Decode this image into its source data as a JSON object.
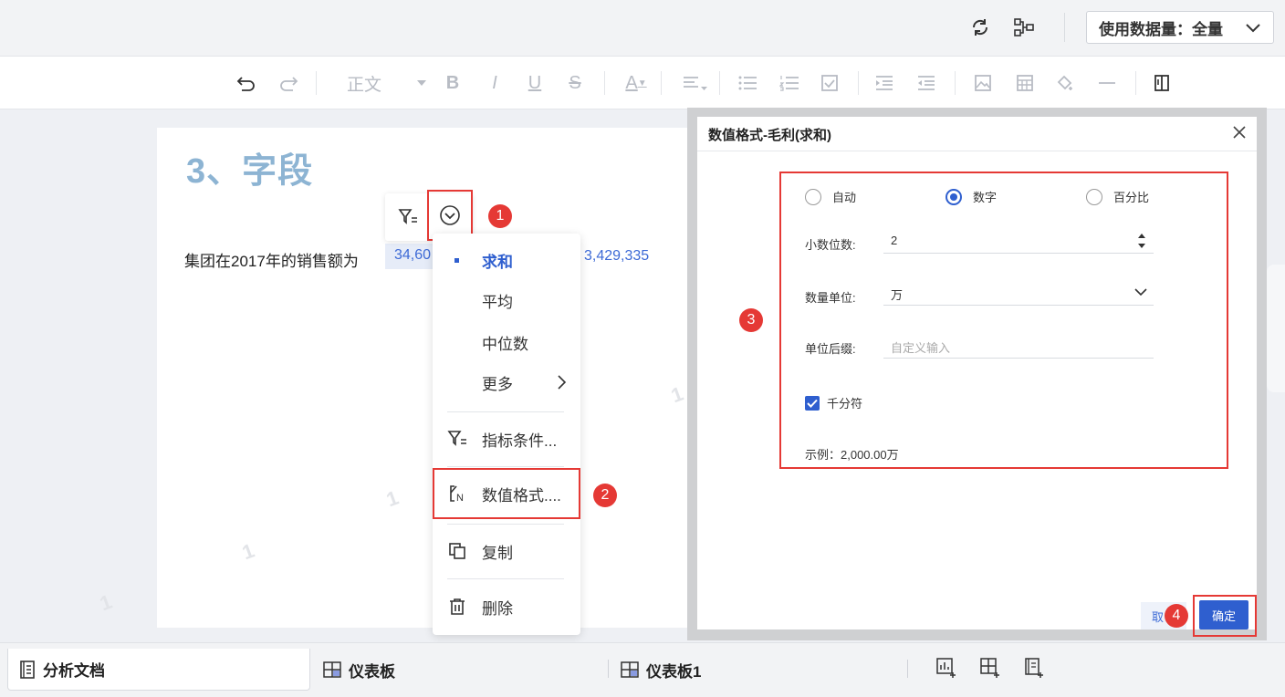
{
  "topbar": {
    "refresh_icon": "refresh-icon",
    "structure_icon": "tree-structure-icon",
    "data_volume_label": "使用数据量：全量"
  },
  "toolbar": {
    "style_select": "正文",
    "items": [
      "undo-icon",
      "redo-icon",
      "bold-icon",
      "italic-icon",
      "underline-icon",
      "strikethrough-icon",
      "font-color-icon",
      "align-icon",
      "bullet-list-icon",
      "numbered-list-icon",
      "checklist-icon",
      "indent-icon",
      "outdent-icon",
      "image-icon",
      "table-icon",
      "link-icon",
      "divider-icon",
      "panel-icon"
    ]
  },
  "document": {
    "title": "3、字段",
    "sentence": "集团在2017年的销售额为",
    "field_chip": "34,60",
    "second_value": "3,429,335",
    "watermark": "1"
  },
  "markers": {
    "m1": "1",
    "m2": "2",
    "m3": "3",
    "m4": "4"
  },
  "context_menu": {
    "agg_sum": "求和",
    "agg_avg": "平均",
    "agg_median": "中位数",
    "more": "更多",
    "filter_condition": "指标条件...",
    "number_format": "数值格式....",
    "copy": "复制",
    "delete": "删除"
  },
  "dialog": {
    "title": "数值格式-毛利(求和)",
    "radio_auto": "自动",
    "radio_number": "数字",
    "radio_percent": "百分比",
    "selected_radio": "数字",
    "decimal_label": "小数位数:",
    "decimal_value": "2",
    "unit_label": "数量单位:",
    "unit_value": "万",
    "suffix_label": "单位后缀:",
    "suffix_placeholder": "自定义输入",
    "thousands_label": "千分符",
    "thousands_checked": true,
    "example": "示例：2,000.00万",
    "cancel_label": "取",
    "ok_label": "确定"
  },
  "bottom_tabs": {
    "tab1": "分析文档",
    "tab2": "仪表板",
    "tab3": "仪表板1"
  },
  "colors": {
    "accent": "#2f5fcf",
    "highlight_red": "#e53935",
    "title_blue": "#8db4d3"
  }
}
